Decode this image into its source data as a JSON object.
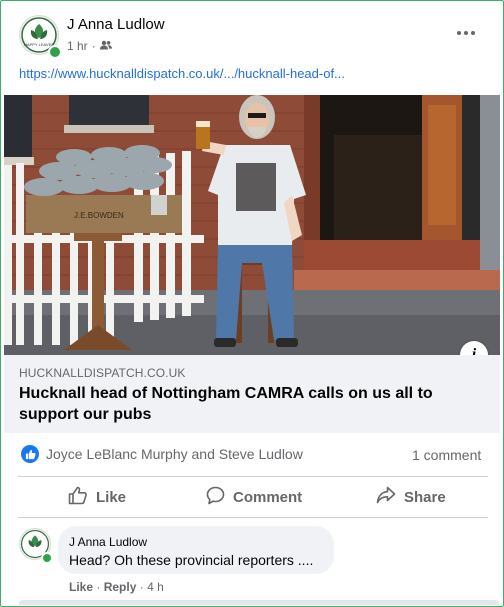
{
  "post": {
    "author": "J Anna Ludlow",
    "time": "1 hr",
    "time_separator": "·",
    "link_url": "https://www.hucknalldispatch.co.uk/.../hucknall-head-of...",
    "avatar_text": "HAPPY LEAVES"
  },
  "preview": {
    "domain": "HUCKNALLDISPATCH.CO.UK",
    "headline": "Hucknall head of Nottingham CAMRA calls on us all to support our pubs",
    "info_icon": "i",
    "photo_sign": "J.E.BOWDEN"
  },
  "engagement": {
    "reactors": "Joyce LeBlanc Murphy and Steve Ludlow",
    "comment_count": "1 comment"
  },
  "actions": {
    "like": "Like",
    "comment": "Comment",
    "share": "Share"
  },
  "comment": {
    "author": "J Anna Ludlow",
    "text": "Head? Oh these provincial reporters ....",
    "like": "Like",
    "separator": "·",
    "reply": "Reply",
    "time": "· 4 h"
  },
  "icons": [
    "friends-icon",
    "more-icon",
    "info-icon",
    "like-reaction-icon",
    "like-icon",
    "comment-icon",
    "share-icon"
  ],
  "colors": {
    "link": "#216fdb",
    "accent": "#1877f2",
    "online": "#31a24c",
    "frame": "#3fae6a"
  }
}
